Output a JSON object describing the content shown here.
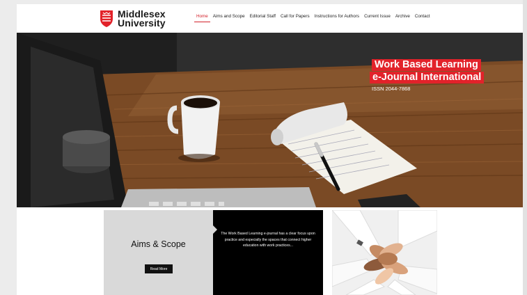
{
  "header": {
    "logo": {
      "line1": "Middlesex",
      "line2": "University"
    },
    "nav": [
      {
        "label": "Home",
        "active": true
      },
      {
        "label": "Aims and Scope"
      },
      {
        "label": "Editorial Staff"
      },
      {
        "label": "Call for Papers"
      },
      {
        "label": "Instructions for Authors"
      },
      {
        "label": "Current Issue"
      },
      {
        "label": "Archive"
      },
      {
        "label": "Contact"
      }
    ]
  },
  "hero": {
    "title_line1": "Work Based Learning",
    "title_line2": "e-Journal International",
    "issn": "ISSN 2044-7868"
  },
  "cards": {
    "aims_title": "Aims & Scope",
    "read_more": "Read More",
    "description": "The Work Based Learning e-journal has a clear focus upon practice and especially the spaces that connect higher education with work practices..."
  },
  "colors": {
    "brand_red": "#e2222a",
    "nav_active": "#d3202a",
    "card_grey": "#d9d9d9",
    "card_black": "#000000"
  },
  "icons": {
    "logo": "middlesex-shield-logo"
  }
}
